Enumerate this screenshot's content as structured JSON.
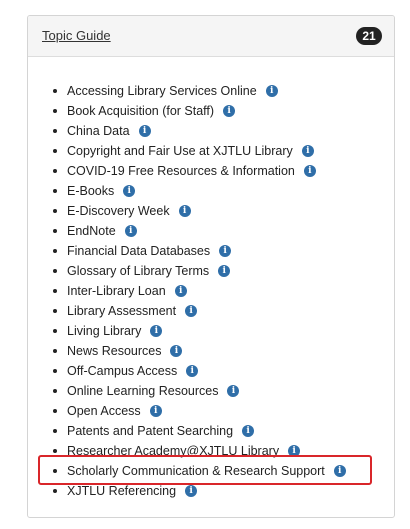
{
  "header": {
    "title": "Topic Guide",
    "count": "21"
  },
  "items": [
    {
      "label": "Accessing Library Services Online",
      "icon": "info-icon"
    },
    {
      "label": "Book Acquisition (for Staff)",
      "icon": "info-icon"
    },
    {
      "label": "China Data",
      "icon": "info-icon"
    },
    {
      "label": "Copyright and Fair Use at XJTLU Library",
      "icon": "info-icon"
    },
    {
      "label": "COVID-19 Free Resources & Information",
      "icon": "info-icon"
    },
    {
      "label": "E-Books",
      "icon": "info-icon"
    },
    {
      "label": "E-Discovery Week",
      "icon": "info-icon"
    },
    {
      "label": "EndNote",
      "icon": "info-icon"
    },
    {
      "label": "Financial Data Databases",
      "icon": "info-icon"
    },
    {
      "label": "Glossary of Library Terms",
      "icon": "info-icon"
    },
    {
      "label": "Inter-Library Loan",
      "icon": "info-icon"
    },
    {
      "label": "Library Assessment",
      "icon": "info-icon"
    },
    {
      "label": "Living Library",
      "icon": "info-icon"
    },
    {
      "label": "News Resources",
      "icon": "info-icon"
    },
    {
      "label": "Off-Campus Access",
      "icon": "info-icon"
    },
    {
      "label": "Online Learning Resources",
      "icon": "info-icon"
    },
    {
      "label": "Open Access",
      "icon": "info-icon"
    },
    {
      "label": "Patents and Patent Searching",
      "icon": "info-icon"
    },
    {
      "label": "Researcher Academy@XJTLU Library",
      "icon": "info-icon"
    },
    {
      "label": "Scholarly Communication & Research Support",
      "icon": "info-icon"
    },
    {
      "label": "XJTLU Referencing",
      "icon": "info-icon"
    }
  ],
  "highlight_color": "#d9262a",
  "info_icon_color": "#2f6ea8"
}
